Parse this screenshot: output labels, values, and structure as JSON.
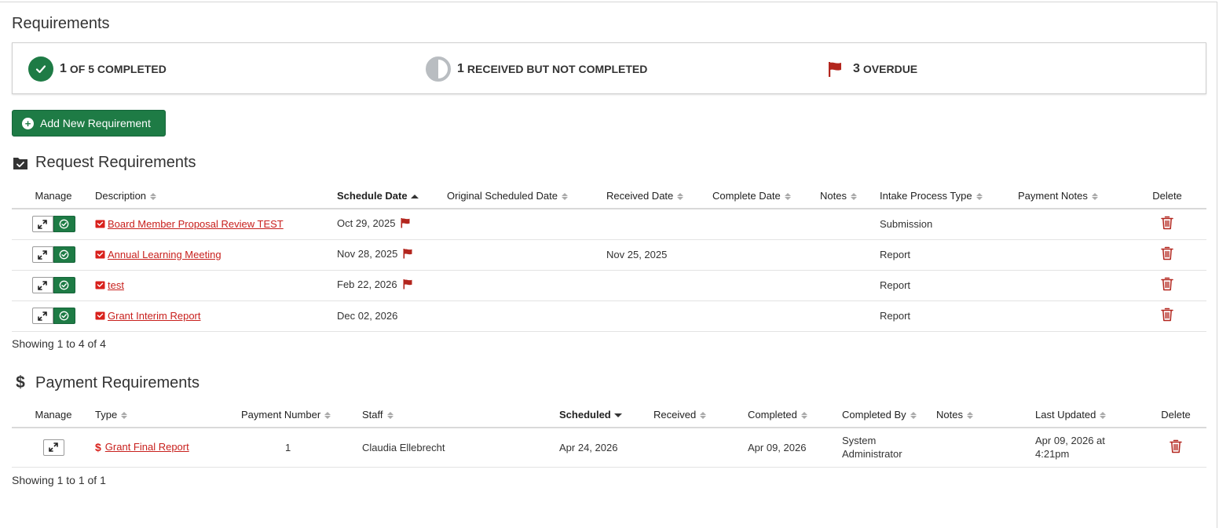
{
  "page": {
    "title": "Requirements"
  },
  "summary": {
    "completed": {
      "count": "1",
      "label": "OF 5 COMPLETED"
    },
    "received": {
      "count": "1",
      "label": "RECEIVED BUT NOT COMPLETED"
    },
    "overdue": {
      "count": "3",
      "label": "OVERDUE"
    }
  },
  "add_button": {
    "label": "Add New Requirement"
  },
  "request_section": {
    "title": "Request Requirements",
    "columns": {
      "manage": "Manage",
      "description": "Description",
      "schedule_date": "Schedule Date",
      "original_scheduled_date": "Original Scheduled Date",
      "received_date": "Received Date",
      "complete_date": "Complete Date",
      "notes": "Notes",
      "intake_process_type": "Intake Process Type",
      "payment_notes": "Payment Notes",
      "delete": "Delete"
    },
    "rows": [
      {
        "description": "Board Member Proposal Review TEST",
        "schedule_date": "Oct 29, 2025",
        "overdue": true,
        "original_scheduled_date": "",
        "received_date": "",
        "complete_date": "",
        "notes": "",
        "intake_process_type": "Submission",
        "payment_notes": ""
      },
      {
        "description": "Annual Learning Meeting",
        "schedule_date": "Nov 28, 2025",
        "overdue": true,
        "original_scheduled_date": "",
        "received_date": "Nov 25, 2025",
        "complete_date": "",
        "notes": "",
        "intake_process_type": "Report",
        "payment_notes": ""
      },
      {
        "description": "test",
        "schedule_date": "Feb 22, 2026",
        "overdue": true,
        "original_scheduled_date": "",
        "received_date": "",
        "complete_date": "",
        "notes": "",
        "intake_process_type": "Report",
        "payment_notes": ""
      },
      {
        "description": "Grant Interim Report",
        "schedule_date": "Dec 02, 2026",
        "overdue": false,
        "original_scheduled_date": "",
        "received_date": "",
        "complete_date": "",
        "notes": "",
        "intake_process_type": "Report",
        "payment_notes": ""
      }
    ],
    "showing": "Showing 1 to 4 of 4"
  },
  "payment_section": {
    "title": "Payment Requirements",
    "columns": {
      "manage": "Manage",
      "type": "Type",
      "payment_number": "Payment Number",
      "staff": "Staff",
      "scheduled": "Scheduled",
      "received": "Received",
      "completed": "Completed",
      "completed_by": "Completed By",
      "notes": "Notes",
      "last_updated": "Last Updated",
      "delete": "Delete"
    },
    "rows": [
      {
        "type": "Grant Final Report",
        "payment_number": "1",
        "staff": "Claudia Ellebrecht",
        "scheduled": "Apr 24, 2026",
        "received": "",
        "completed": "Apr 09, 2026",
        "completed_by": "System Administrator",
        "notes": "",
        "last_updated": "Apr 09, 2026 at 4:21pm"
      }
    ],
    "showing": "Showing 1 to 1 of 1"
  },
  "colors": {
    "accent_green": "#1e7b45",
    "link_red": "#c8201d",
    "flag_red": "#b3261e",
    "trash_red": "#b3261e"
  }
}
